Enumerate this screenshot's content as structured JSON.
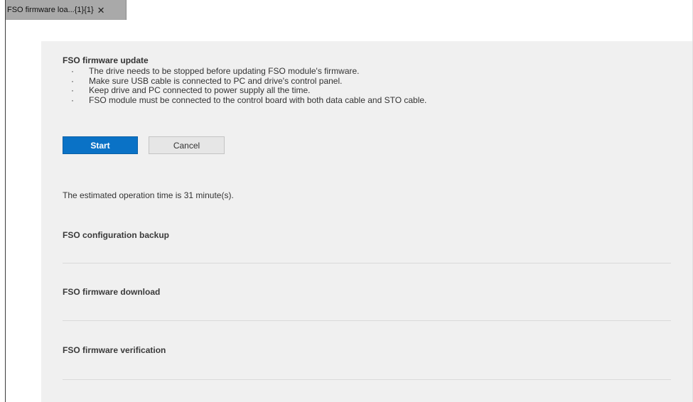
{
  "tab": {
    "title": "FSO firmware loa...{1}{1}",
    "close_glyph": "✕"
  },
  "panel": {
    "title": "FSO firmware update",
    "bullet_glyph": "·",
    "bullets": [
      "The drive needs to be stopped before updating FSO module's firmware.",
      "Make sure USB cable is connected to PC and drive's control panel.",
      "Keep drive and PC connected to power supply all the time.",
      "FSO module must be connected to the control board with both data cable and STO cable."
    ],
    "start_label": "Start",
    "cancel_label": "Cancel",
    "estimate_text": "The estimated operation time is 31 minute(s).",
    "steps": [
      "FSO configuration backup",
      "FSO firmware download",
      "FSO firmware verification"
    ]
  },
  "colors": {
    "tab_background": "#a9a9a9",
    "panel_background": "#f0f0f0",
    "primary_button": "#0a72c6",
    "secondary_button": "#e6e6e6"
  },
  "icons": {
    "tab_close": "close-icon"
  }
}
